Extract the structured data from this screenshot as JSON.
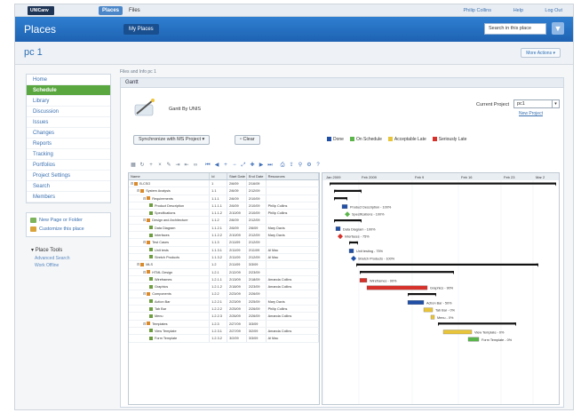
{
  "topbar": {
    "logo": "UNICanv",
    "tabs": [
      "Places",
      "Files"
    ],
    "links": [
      "Philip Collins",
      "Help",
      "Log Out"
    ]
  },
  "band": {
    "title": "Places",
    "my_places": "My Places",
    "search_placeholder": "Search in this place",
    "filter_icon": "filter-icon"
  },
  "place": {
    "name": "pc 1",
    "more_actions": "More Actions"
  },
  "sidebar": {
    "items": [
      {
        "label": "Home",
        "active": false
      },
      {
        "label": "Schedule",
        "active": true
      },
      {
        "label": "Library",
        "active": false
      },
      {
        "label": "Discussion",
        "active": false
      },
      {
        "label": "Issues",
        "active": false
      },
      {
        "label": "Changes",
        "active": false
      },
      {
        "label": "Reports",
        "active": false
      },
      {
        "label": "Tracking",
        "active": false
      },
      {
        "label": "Portfolios",
        "active": false
      },
      {
        "label": "Project Settings",
        "active": false
      },
      {
        "label": "Search",
        "active": false
      },
      {
        "label": "Members",
        "active": false
      }
    ],
    "links": [
      {
        "label": "New Page or Folder",
        "color": "#7db35a"
      },
      {
        "label": "Customize this place",
        "color": "#d9a43a"
      }
    ],
    "tools_title": "Place Tools",
    "tools": [
      "Advanced Search",
      "Work Offline"
    ]
  },
  "main": {
    "breadcrumb": "Files and Info pc 1",
    "panel_title": "Gantt",
    "app_name": "Gantt By UNIS",
    "current_project_label": "Current Project",
    "current_project_value": "pc1",
    "new_project": "New Project",
    "sync_button": "Synchronize with MS Project",
    "clear_button": "Clear",
    "legend": [
      {
        "label": "Done",
        "color": "#1f4fa6"
      },
      {
        "label": "On Schedule",
        "color": "#5ab54a"
      },
      {
        "label": "Acceptable Late",
        "color": "#e8c43a"
      },
      {
        "label": "Seriously Late",
        "color": "#d6312b"
      }
    ],
    "toolbar_icons": [
      "grid-icon",
      "refresh-icon",
      "add-icon",
      "delete-icon",
      "edit-icon",
      "indent-icon",
      "outdent-icon",
      "link-icon",
      "first-icon",
      "prev-icon",
      "zoom-in-icon",
      "zoom-out-icon",
      "fit-icon",
      "expand-icon",
      "next-icon",
      "last-icon",
      "print-icon",
      "export-icon",
      "filter-icon",
      "settings-icon",
      "help-icon"
    ],
    "grid": {
      "headers": [
        "Name",
        "Id",
        "Start Date",
        "End Date",
        "Resources"
      ],
      "rows": [
        {
          "level": 0,
          "type": "summary",
          "name": "B-CSO",
          "id": "1",
          "sd": "2/6/09",
          "ed": "2/16/09",
          "res": ""
        },
        {
          "level": 1,
          "type": "summary",
          "name": "System Analysis",
          "id": "1.1",
          "sd": "2/6/09",
          "ed": "2/12/09",
          "res": ""
        },
        {
          "level": 2,
          "type": "summary",
          "name": "Requirements",
          "id": "1.1.1",
          "sd": "2/6/09",
          "ed": "2/10/09",
          "res": ""
        },
        {
          "level": 3,
          "type": "task",
          "name": "Product Description",
          "id": "1.1.1.1",
          "sd": "2/6/09",
          "ed": "2/10/09",
          "res": "Philip Collins"
        },
        {
          "level": 3,
          "type": "task",
          "name": "Specifications",
          "id": "1.1.1.2",
          "sd": "2/10/09",
          "ed": "2/10/09",
          "res": "Philip Collins"
        },
        {
          "level": 2,
          "type": "summary",
          "name": "Design and Architecture",
          "id": "1.1.2",
          "sd": "2/6/09",
          "ed": "2/12/09",
          "res": ""
        },
        {
          "level": 3,
          "type": "task",
          "name": "Data Diagram",
          "id": "1.1.2.1",
          "sd": "2/6/09",
          "ed": "2/6/09",
          "res": "Mary Davis"
        },
        {
          "level": 3,
          "type": "task",
          "name": "Interfaces",
          "id": "1.1.2.2",
          "sd": "2/10/09",
          "ed": "2/12/09",
          "res": "Mary Davis"
        },
        {
          "level": 2,
          "type": "summary",
          "name": "Test Cases",
          "id": "1.1.3",
          "sd": "2/11/09",
          "ed": "2/12/09",
          "res": ""
        },
        {
          "level": 3,
          "type": "task",
          "name": "Unit tests",
          "id": "1.1.3.1",
          "sd": "2/11/09",
          "ed": "2/11/09",
          "res": "Al Mac"
        },
        {
          "level": 3,
          "type": "task",
          "name": "Stretch Products",
          "id": "1.1.3.2",
          "sd": "2/11/09",
          "ed": "2/12/09",
          "res": "Al Mac"
        },
        {
          "level": 1,
          "type": "summary",
          "name": "MLS",
          "id": "1.2",
          "sd": "2/11/09",
          "ed": "3/3/09",
          "res": ""
        },
        {
          "level": 2,
          "type": "summary",
          "name": "HTML Design",
          "id": "1.2.1",
          "sd": "2/12/09",
          "ed": "2/23/09",
          "res": ""
        },
        {
          "level": 3,
          "type": "task",
          "name": "Wireframes",
          "id": "1.2.1.1",
          "sd": "2/13/09",
          "ed": "2/18/09",
          "res": "Amanda Collins"
        },
        {
          "level": 3,
          "type": "task",
          "name": "Graphics",
          "id": "1.2.1.2",
          "sd": "2/18/09",
          "ed": "2/23/09",
          "res": "Amanda Collins"
        },
        {
          "level": 2,
          "type": "summary",
          "name": "Components",
          "id": "1.2.2",
          "sd": "2/23/09",
          "ed": "2/26/09",
          "res": ""
        },
        {
          "level": 3,
          "type": "task",
          "name": "Action Bar",
          "id": "1.2.2.1",
          "sd": "2/23/09",
          "ed": "2/25/09",
          "res": "Mary Davis"
        },
        {
          "level": 3,
          "type": "task",
          "name": "Tab Bar",
          "id": "1.2.2.2",
          "sd": "2/25/09",
          "ed": "2/26/09",
          "res": "Philip Collins"
        },
        {
          "level": 3,
          "type": "task",
          "name": "Menu",
          "id": "1.2.2.3",
          "sd": "2/26/09",
          "ed": "2/26/09",
          "res": "Amanda Collins"
        },
        {
          "level": 2,
          "type": "summary",
          "name": "Templates",
          "id": "1.2.3",
          "sd": "2/27/09",
          "ed": "3/3/09",
          "res": ""
        },
        {
          "level": 3,
          "type": "task",
          "name": "View Template",
          "id": "1.2.3.1",
          "sd": "2/27/09",
          "ed": "3/2/09",
          "res": "Amanda Collins"
        },
        {
          "level": 3,
          "type": "task",
          "name": "Form Template",
          "id": "1.2.3.2",
          "sd": "3/2/09",
          "ed": "3/3/09",
          "res": "Al Mac"
        }
      ]
    },
    "timeline_labels": [
      "Jan 2009",
      "Feb 2009",
      "Feb 9",
      "Feb 16",
      "Feb 23",
      "Mar 2"
    ],
    "gantt": [
      {
        "kind": "summary",
        "start": 0,
        "end": 255
      },
      {
        "kind": "summary",
        "start": 5,
        "end": 36
      },
      {
        "kind": "summary",
        "start": 5,
        "end": 20
      },
      {
        "kind": "task",
        "start": 14,
        "end": 20,
        "color": "#1f4fa6",
        "label": "Product Description - 100%"
      },
      {
        "kind": "milestone",
        "start": 20,
        "end": 20,
        "color": "#5ab54a",
        "label": "Specifications - 100%"
      },
      {
        "kind": "summary",
        "start": 5,
        "end": 36
      },
      {
        "kind": "task",
        "start": 7,
        "end": 12,
        "color": "#1f4fa6",
        "label": "Data Diagram - 100%"
      },
      {
        "kind": "milestone",
        "start": 12,
        "end": 12,
        "color": "#d6312b",
        "label": "Interfaces - 75%"
      },
      {
        "kind": "summary",
        "start": 22,
        "end": 32
      },
      {
        "kind": "task",
        "start": 22,
        "end": 27,
        "color": "#1f4fa6",
        "label": "Unit testing - 75%"
      },
      {
        "kind": "milestone",
        "start": 27,
        "end": 27,
        "color": "#1f4fa6",
        "label": "Stretch Products - 100%"
      },
      {
        "kind": "summary",
        "start": 30,
        "end": 235
      },
      {
        "kind": "summary",
        "start": 34,
        "end": 140
      },
      {
        "kind": "task",
        "start": 34,
        "end": 42,
        "color": "#d6312b",
        "label": "Wireframes - 90%"
      },
      {
        "kind": "task",
        "start": 42,
        "end": 110,
        "color": "#d6312b",
        "label": "Graphics - 90%"
      },
      {
        "kind": "summary",
        "start": 88,
        "end": 120
      },
      {
        "kind": "task",
        "start": 88,
        "end": 106,
        "color": "#1f4fa6",
        "label": "Action Bar - 50%"
      },
      {
        "kind": "task",
        "start": 106,
        "end": 116,
        "color": "#e8c43a",
        "label": "Tab Bar - 0%"
      },
      {
        "kind": "task",
        "start": 114,
        "end": 118,
        "color": "#e8c43a",
        "label": "Menu - 0%"
      },
      {
        "kind": "summary",
        "start": 122,
        "end": 210
      },
      {
        "kind": "task",
        "start": 128,
        "end": 160,
        "color": "#e8c43a",
        "label": "View Template - 0%"
      },
      {
        "kind": "task",
        "start": 156,
        "end": 168,
        "color": "#5ab54a",
        "label": "Form Template - 0%"
      }
    ]
  }
}
